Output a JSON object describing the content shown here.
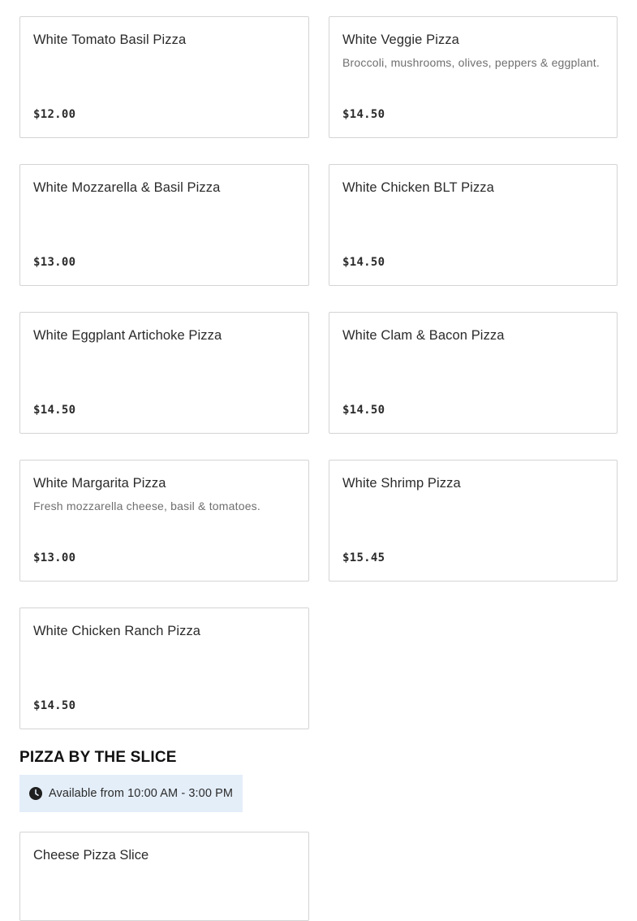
{
  "menu_items": [
    {
      "name": "White Tomato Basil Pizza",
      "description": "",
      "price": "$12.00"
    },
    {
      "name": "White Veggie Pizza",
      "description": "Broccoli, mushrooms, olives, peppers & eggplant.",
      "price": "$14.50"
    },
    {
      "name": "White Mozzarella & Basil Pizza",
      "description": "",
      "price": "$13.00"
    },
    {
      "name": "White Chicken BLT Pizza",
      "description": "",
      "price": "$14.50"
    },
    {
      "name": "White Eggplant Artichoke Pizza",
      "description": "",
      "price": "$14.50"
    },
    {
      "name": "White Clam & Bacon Pizza",
      "description": "",
      "price": "$14.50"
    },
    {
      "name": "White Margarita Pizza",
      "description": "Fresh mozzarella cheese, basil & tomatoes.",
      "price": "$13.00"
    },
    {
      "name": "White Shrimp Pizza",
      "description": "",
      "price": "$15.45"
    },
    {
      "name": "White Chicken Ranch Pizza",
      "description": "",
      "price": "$14.50"
    }
  ],
  "slice_section": {
    "title": "PIZZA BY THE SLICE",
    "availability": "Available from 10:00 AM - 3:00 PM",
    "availability_icon": "clock-icon",
    "items": [
      {
        "name": "Cheese Pizza Slice"
      }
    ]
  }
}
